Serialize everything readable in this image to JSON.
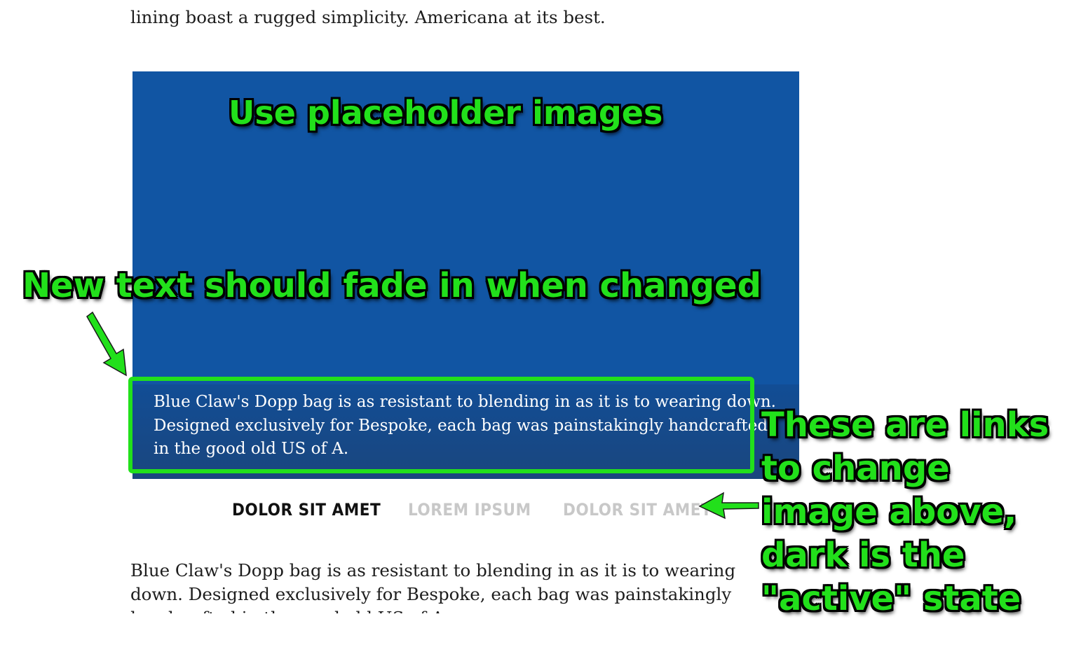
{
  "article": {
    "intro_line": "lining boast a rugged simplicity. Americana at its best.",
    "body_text": "Blue Claw's Dopp bag is as resistant to blending in as it is to wearing down. Designed exclusively for Bespoke, each bag was painstakingly handcrafted in the good old US of A."
  },
  "hero": {
    "background_color": "#1155a3",
    "caption": {
      "line1": "Blue Claw's Dopp bag is as resistant to blending in as it is to wearing down.",
      "line2": "Designed exclusively for Bespoke, each bag was painstakingly handcrafted",
      "line3": "in the good old US of A."
    }
  },
  "tabs": [
    {
      "label": "DOLOR SIT AMET",
      "active": true
    },
    {
      "label": "LOREM IPSUM",
      "active": false
    },
    {
      "label": "DOLOR SIT AMET",
      "active": false
    }
  ],
  "annotations": {
    "placeholder_note": "Use placeholder images",
    "fade_note": "New text should fade in when changed",
    "links_note": "These are links to change image above, dark is the \"active\" state",
    "color": "#22e01b"
  }
}
